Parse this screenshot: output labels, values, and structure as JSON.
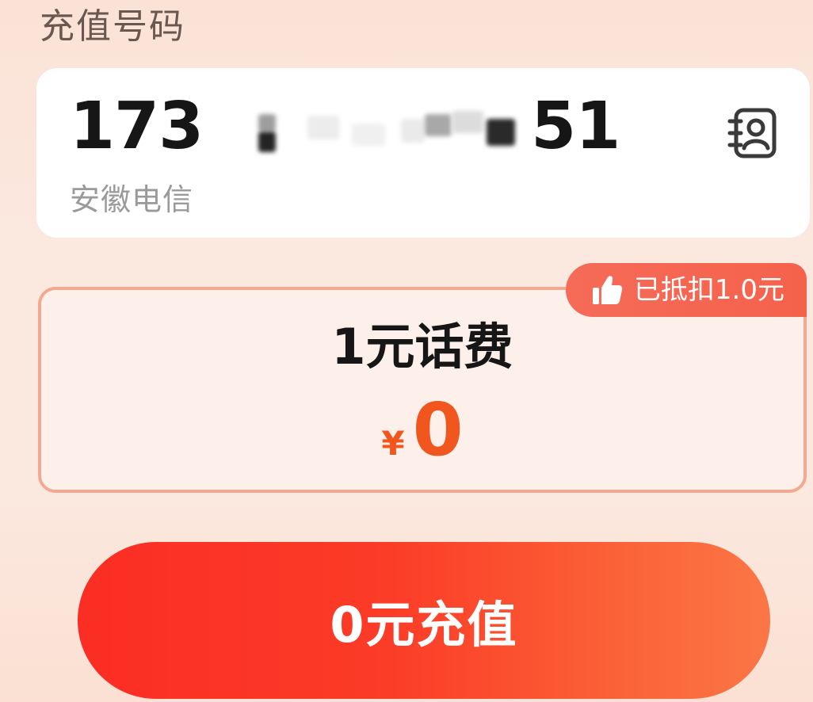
{
  "section": {
    "title": "充值号码"
  },
  "phone": {
    "prefix": "173",
    "suffix": "51",
    "carrier": "安徽电信"
  },
  "product": {
    "name": "1元话费",
    "currency": "¥",
    "price": "0",
    "discount_badge": "已抵扣1.0元"
  },
  "action": {
    "recharge_label": "0元充值"
  },
  "colors": {
    "accent": "#f0561e",
    "button_start": "#fb2d24",
    "button_end": "#fb7646",
    "badge": "#f56b58",
    "card_border": "#f3a98f"
  },
  "icons": {
    "contacts": "contact-book-icon",
    "badge": "thumbs-up-icon"
  }
}
